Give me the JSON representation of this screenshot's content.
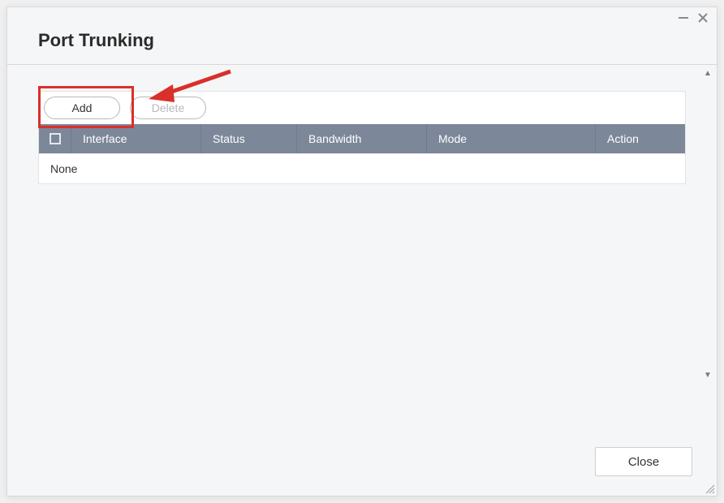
{
  "title": "Port Trunking",
  "toolbar": {
    "add_label": "Add",
    "delete_label": "Delete"
  },
  "table": {
    "columns": {
      "interface": "Interface",
      "status": "Status",
      "bandwidth": "Bandwidth",
      "mode": "Mode",
      "action": "Action"
    },
    "empty_text": "None"
  },
  "buttons": {
    "close": "Close"
  }
}
